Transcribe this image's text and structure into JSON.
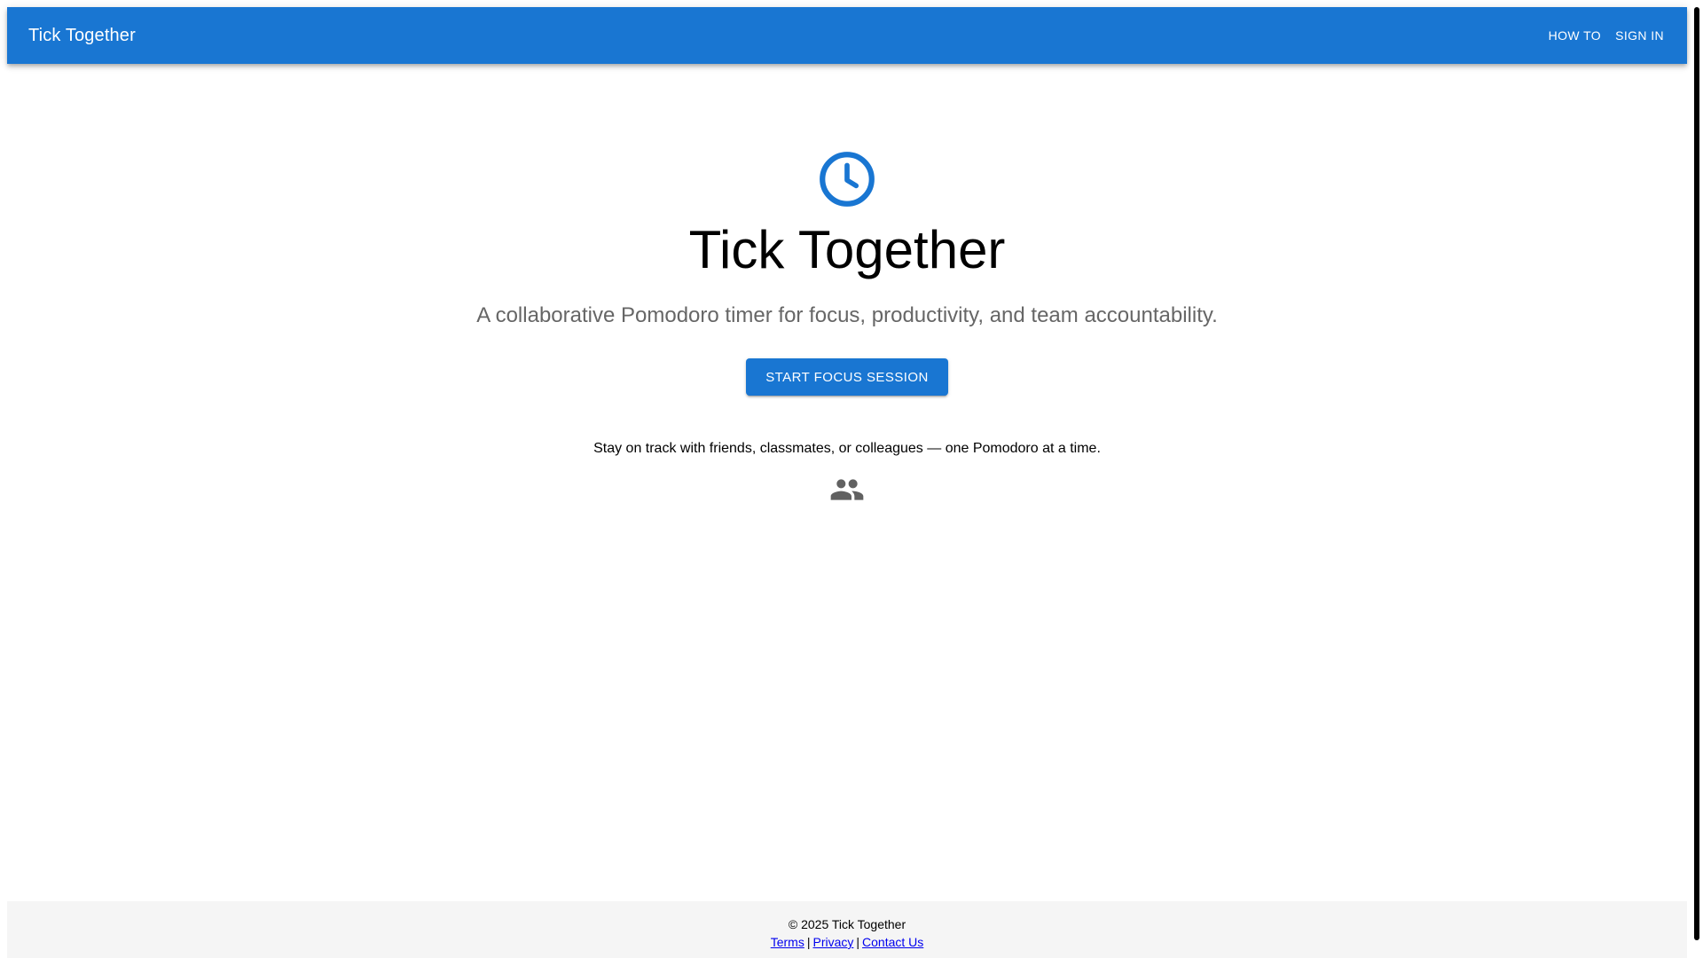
{
  "appbar": {
    "brand": "Tick Together",
    "nav": {
      "how_to": "HOW TO",
      "sign_in": "SIGN IN"
    },
    "color": "#1976d2"
  },
  "hero": {
    "icon": "clock-icon",
    "title": "Tick Together",
    "subtitle": "A collaborative Pomodoro timer for focus, productivity, and team accountability.",
    "cta_label": "START FOCUS SESSION",
    "tagline": "Stay on track with friends, classmates, or colleagues — one Pomodoro at a time.",
    "tagline_icon": "group-icon"
  },
  "footer": {
    "copyright": "© 2025 Tick Together",
    "links": {
      "terms": "Terms",
      "privacy": "Privacy",
      "contact": "Contact Us"
    },
    "separator": "|"
  },
  "colors": {
    "primary": "#1976d2",
    "subtitle": "#666666",
    "icon_gray": "#616161",
    "footer_bg": "#f5f5f5",
    "link": "#0000ee"
  }
}
